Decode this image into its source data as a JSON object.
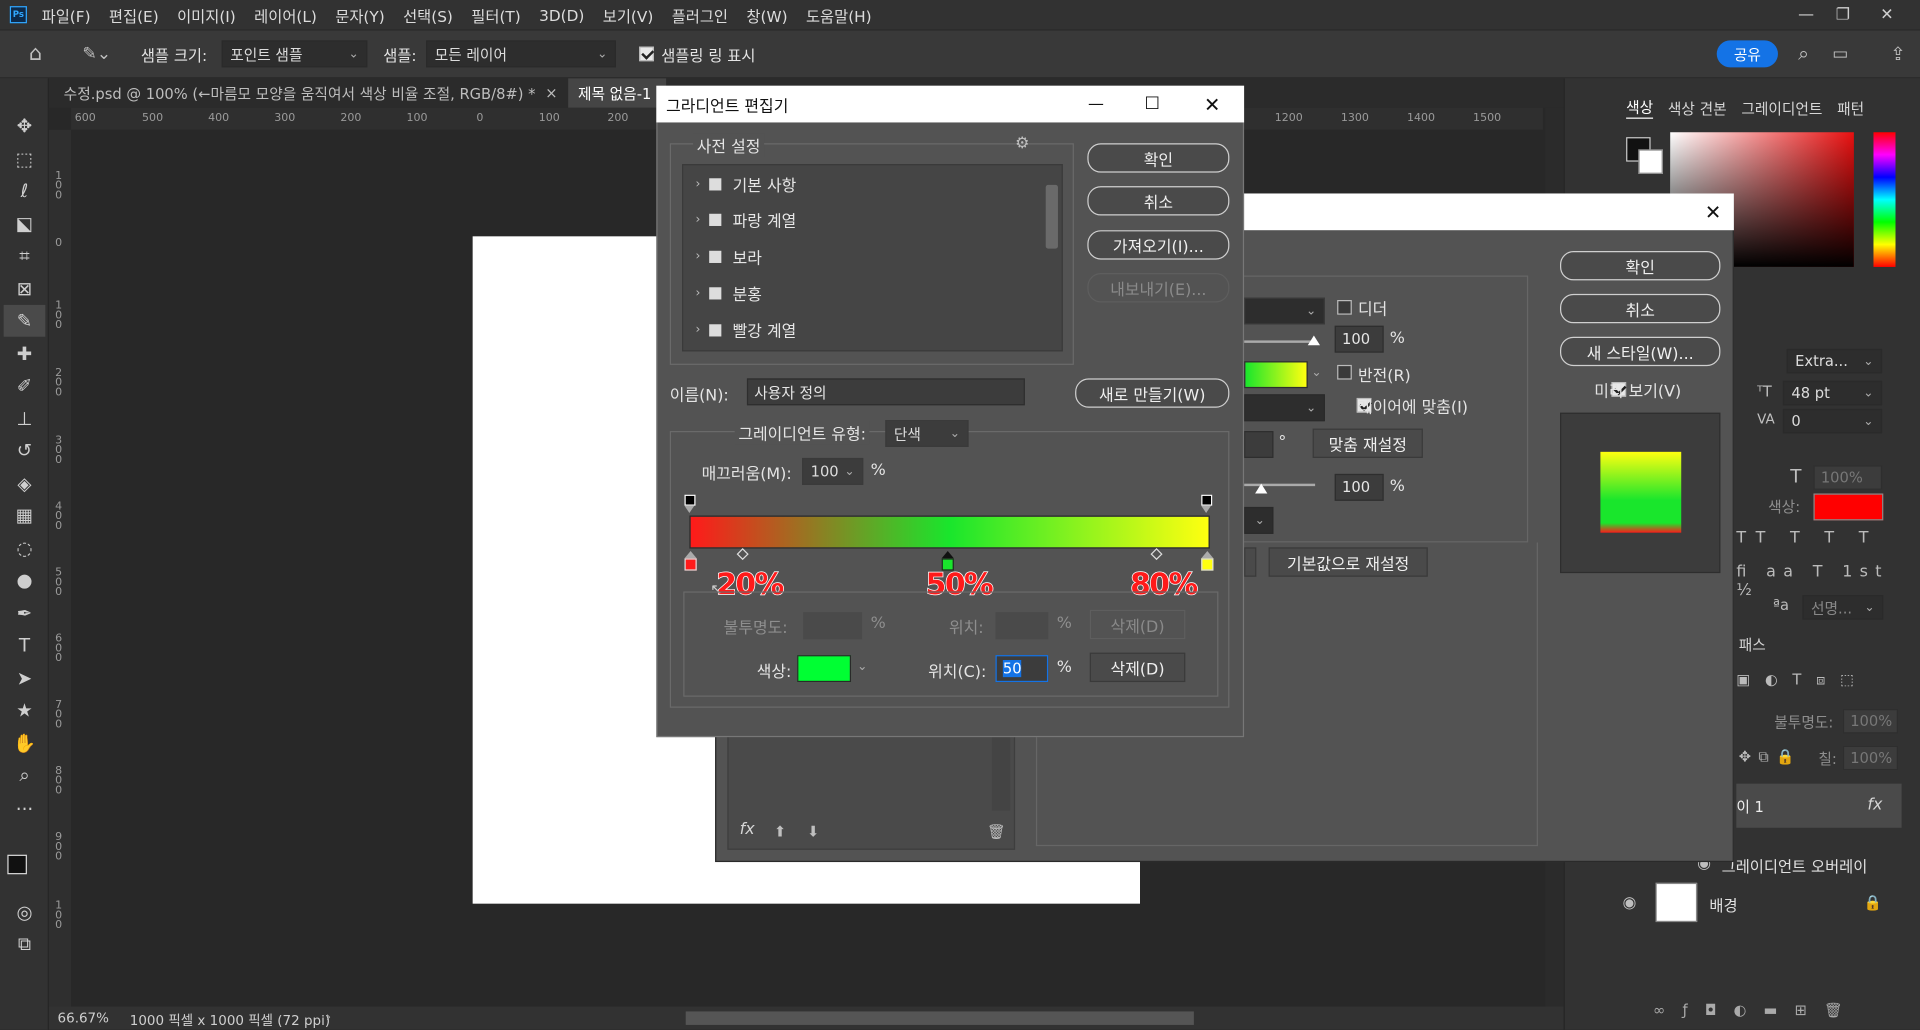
{
  "menu": [
    "파일(F)",
    "편집(E)",
    "이미지(I)",
    "레이어(L)",
    "문자(Y)",
    "선택(S)",
    "필터(T)",
    "3D(D)",
    "보기(V)",
    "플러그인",
    "창(W)",
    "도움말(H)"
  ],
  "options": {
    "sample_size_label": "샘플 크기:",
    "sample_size_value": "포인트 샘플",
    "sample_label": "샘플:",
    "sample_value": "모든 레이어",
    "ring_label": "샘플링 링 표시",
    "share_label": "공유"
  },
  "tabs": [
    {
      "label": "수정.psd @ 100% (←마름모 모양을 움직여서 색상 비율 조절, RGB/8#) *",
      "close": "×"
    },
    {
      "label": "제목 없음-1"
    }
  ],
  "ruler_h": [
    "600",
    "500",
    "400",
    "300",
    "200",
    "100",
    "0",
    "100",
    "200",
    "1200",
    "1300",
    "1400",
    "1500"
  ],
  "ruler_v": [
    "1 0 0",
    "0",
    "1 0 0",
    "2 0 0",
    "3 0 0",
    "4 0 0",
    "5 0 0",
    "6 0 0",
    "7 0 0",
    "8 0 0",
    "9 0 0",
    "1 0 0"
  ],
  "status": {
    "zoom": "66.67%",
    "doc_info": "1000 픽셀 x 1000 픽셀 (72 ppi)"
  },
  "gradient_editor": {
    "title": "그라디언트 편집기",
    "presets_label": "사전 설정",
    "presets": [
      "기본 사항",
      "파랑 계열",
      "보라",
      "분홍",
      "빨강 계열"
    ],
    "buttons": {
      "ok": "확인",
      "cancel": "취소",
      "import": "가져오기(I)...",
      "export": "내보내기(E)...",
      "new": "새로 만들기(W)"
    },
    "name_label": "이름(N):",
    "name_value": "사용자 정의",
    "type_label": "그레이디언트 유형:",
    "type_value": "단색",
    "smooth_label": "매끄러움(M):",
    "smooth_value": "100",
    "pct": "%",
    "stops_labels": [
      "20%",
      "50%",
      "80%"
    ],
    "opacity_label": "불투명도:",
    "location_label": "위치:",
    "delete_label": "삭제(D)",
    "color_label": "색상:",
    "color_location_label": "위치(C):",
    "color_location_value": "50",
    "gradient_colors": [
      "#ff1a1a",
      "#19e62c",
      "#ffff10"
    ],
    "stop_color": "#00ff33"
  },
  "layer_style": {
    "ok": "확인",
    "cancel": "취소",
    "new_style": "새 스타일(W)...",
    "preview": "미리 보기(V)",
    "dither": "디더",
    "reverse": "반전(R)",
    "align": "레이어에 맞춤(I)",
    "reset_align": "맞춤 재설정",
    "reset_default": "기본값으로 재설정",
    "v100a": "100",
    "v100b": "100",
    "pct": "%",
    "deg": "°",
    "fx": "fx"
  },
  "right_panel": {
    "tabs": [
      "색상",
      "색상 견본",
      "그레이디언트",
      "패턴"
    ],
    "char": {
      "font_style": "Extra...",
      "size": "48 pt",
      "tracking": "0",
      "scale": "100%",
      "color_label": "색상:",
      "aa": "선명..."
    },
    "paths_tab": "패스",
    "layer_opacity_label": "불투명도:",
    "layer_opacity": "100%",
    "fill_label": "칠:",
    "fill": "100%",
    "layers": [
      {
        "name": "이 1",
        "fx": "fx"
      },
      {
        "name": "그레이디언트 오버레이"
      },
      {
        "name": "배경"
      }
    ]
  }
}
